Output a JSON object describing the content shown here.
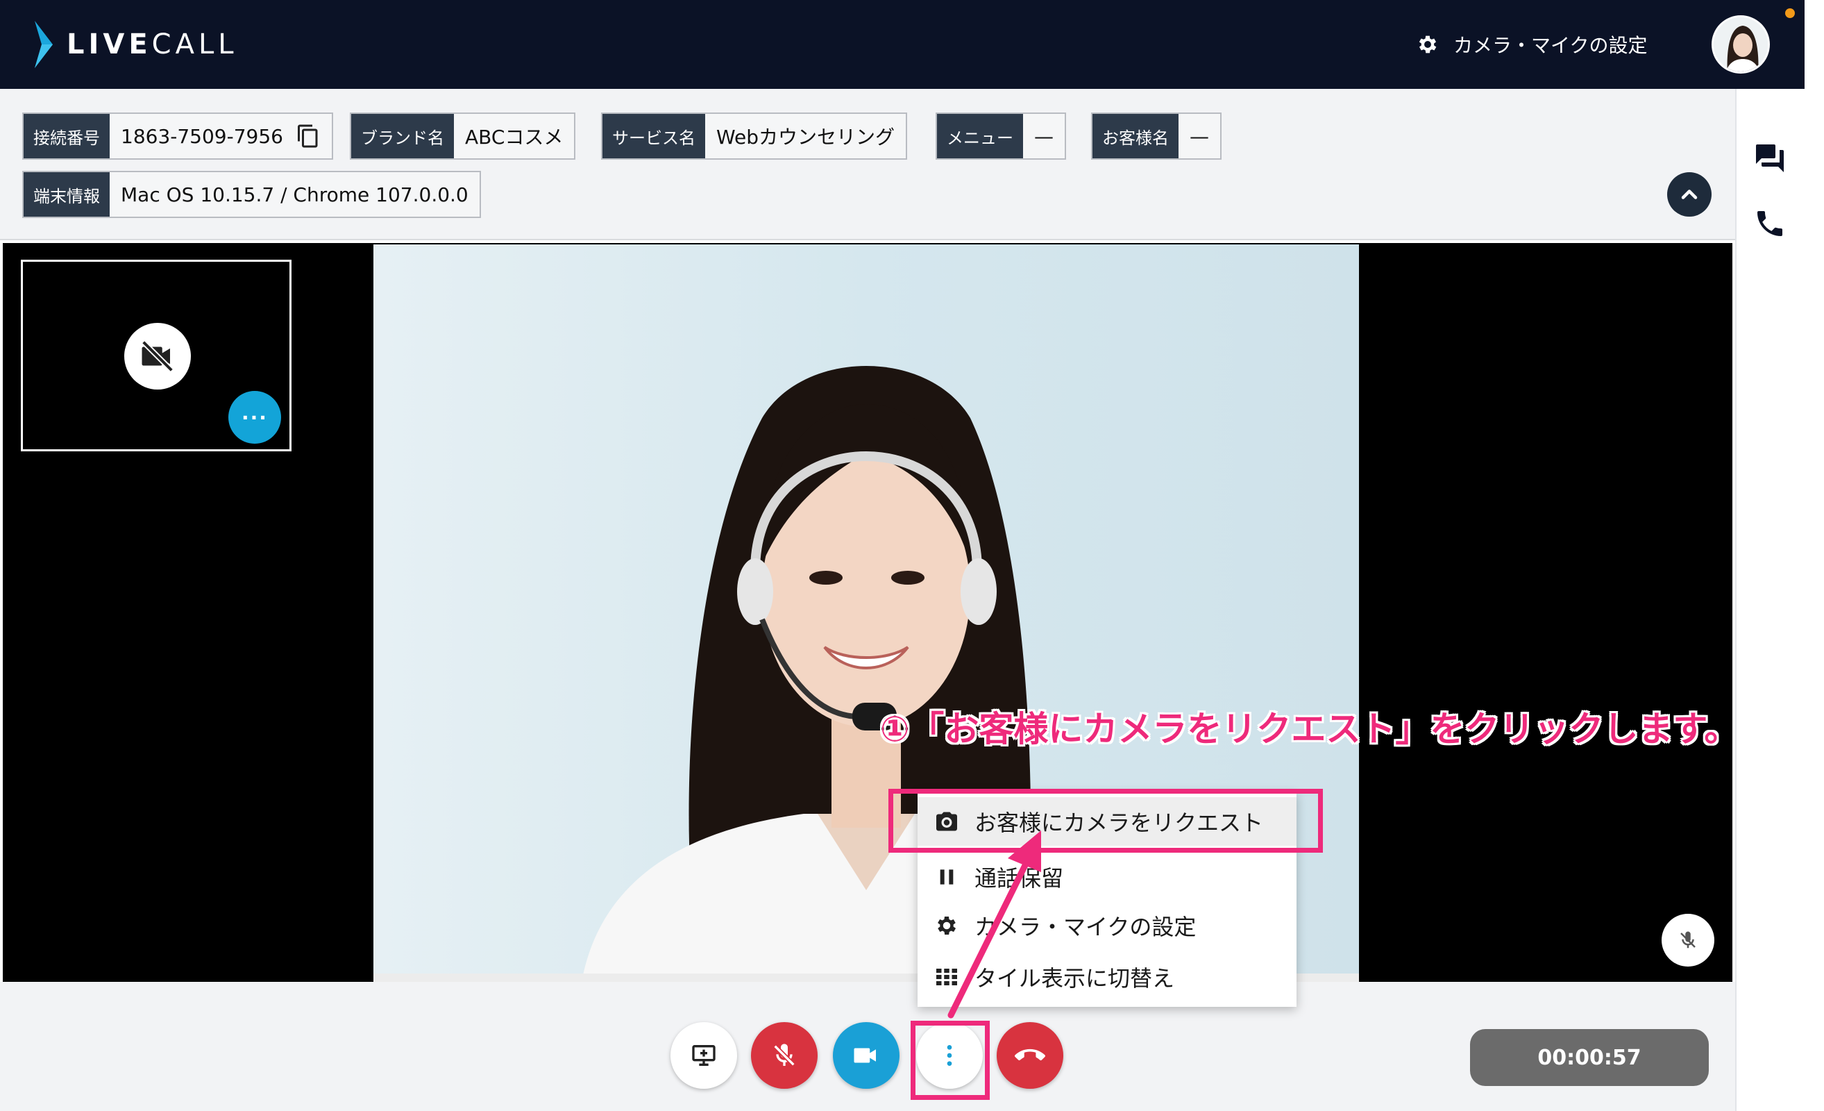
{
  "app": {
    "logo_text_bold": "LIVE",
    "logo_text_light": "CALL"
  },
  "header": {
    "settings_label": "カメラ・マイクの設定"
  },
  "info": {
    "connection": {
      "label": "接続番号",
      "value": "1863-7509-7956"
    },
    "brand": {
      "label": "ブランド名",
      "value": "ABCコスメ"
    },
    "service": {
      "label": "サービス名",
      "value": "Webカウンセリング"
    },
    "menu": {
      "label": "メニュー",
      "value": "—"
    },
    "customer": {
      "label": "お客様名",
      "value": "—"
    },
    "device": {
      "label": "端末情報",
      "value": "Mac OS 10.15.7 / Chrome 107.0.0.0"
    }
  },
  "self_view": {
    "more_label": "···"
  },
  "popup_menu": {
    "items": [
      {
        "label": "お客様にカメラをリクエスト",
        "icon": "camera-icon"
      },
      {
        "label": "通話保留",
        "icon": "pause-icon"
      },
      {
        "label": "カメラ・マイクの設定",
        "icon": "gear-icon"
      },
      {
        "label": "タイル表示に切替え",
        "icon": "grid-icon"
      }
    ]
  },
  "controls": {
    "timer": "00:00:57",
    "buttons": [
      "screen-share-icon",
      "mic-off-icon",
      "video-camera-icon",
      "more-vertical-icon",
      "hang-up-icon"
    ]
  },
  "annotation": {
    "callout": "①「お客様にカメラをリクエスト」をクリックします。"
  },
  "colors": {
    "header_bg": "#0b1226",
    "accent_blue": "#13a4d8",
    "danger_red": "#d8333f",
    "annotation_pink": "#ee2a7b",
    "label_bg": "#2d3a4a"
  }
}
